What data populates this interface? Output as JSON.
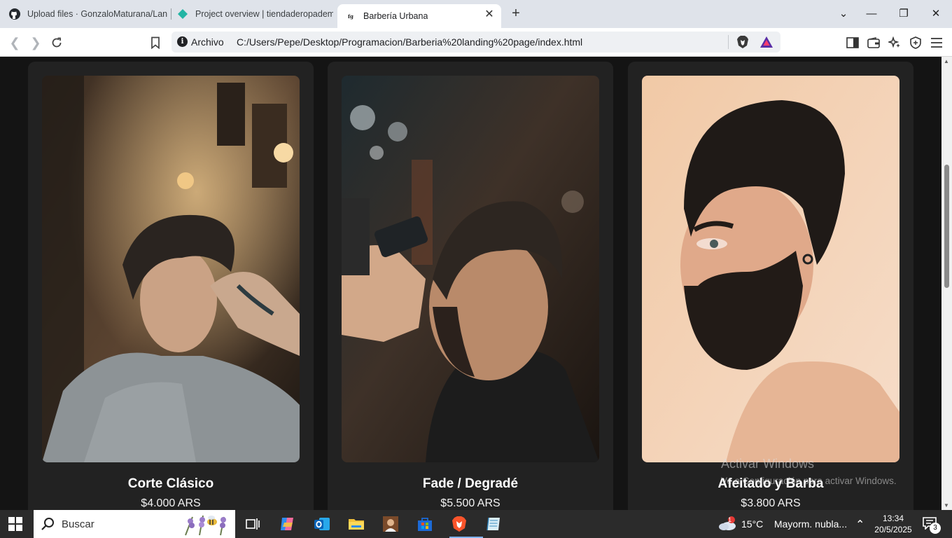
{
  "browser": {
    "tabs": [
      {
        "label": "Upload files · GonzaloMaturana/Lan",
        "icon": "github-icon"
      },
      {
        "label": "Project overview | tiendaderopadem",
        "icon": "diamond-icon"
      },
      {
        "label": "Barbería Urbana",
        "icon": "site-logo-icon",
        "active": true
      }
    ],
    "active_tab_favicon": "fg"
  },
  "toolbar": {
    "scheme_label": "Archivo",
    "url": "C:/Users/Pepe/Desktop/Programacion/Barberia%20landing%20page/index.html"
  },
  "services": [
    {
      "title": "Corte Clásico",
      "price": "$4.000 ARS",
      "photo": "classic-cut-photo"
    },
    {
      "title": "Fade / Degradé",
      "price": "$5.500 ARS",
      "photo": "fade-photo"
    },
    {
      "title": "Afeitado y Barba",
      "price": "$3.800 ARS",
      "photo": "beard-photo"
    }
  ],
  "watermark": {
    "line1": "Activar Windows",
    "line2": "Ve a Configuración para activar Windows."
  },
  "taskbar": {
    "search_label": "Buscar",
    "weather_temp": "15°C",
    "weather_desc": "Mayorm. nubla...",
    "weather_badge": "1",
    "time": "13:34",
    "date": "20/5/2025",
    "notification_count": "3"
  },
  "colors": {
    "page_bg": "#141414",
    "card_bg": "#222222",
    "tab_strip": "#dfe3ea",
    "taskbar": "#2b2b2b"
  }
}
